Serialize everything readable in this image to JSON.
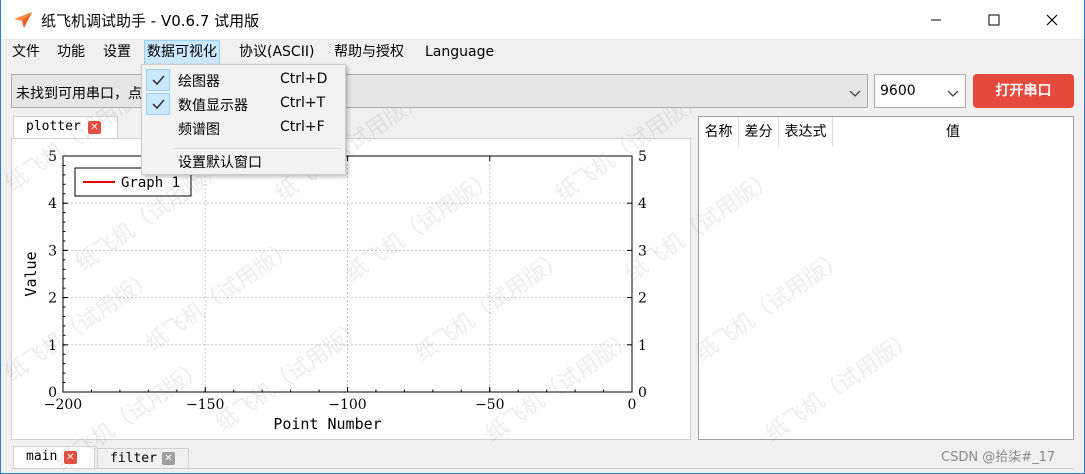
{
  "window": {
    "title": "纸飞机调试助手 - V0.6.7 试用版",
    "icon": "paper-plane-icon"
  },
  "menubar": {
    "items": [
      {
        "label": "文件"
      },
      {
        "label": "功能"
      },
      {
        "label": "设置"
      },
      {
        "label": "数据可视化",
        "active": true
      },
      {
        "label": "协议(ASCII)"
      },
      {
        "label": "帮助与授权"
      },
      {
        "label": "Language"
      }
    ]
  },
  "dropdown": {
    "items": [
      {
        "label": "绘图器",
        "shortcut": "Ctrl+D",
        "checked": true
      },
      {
        "label": "数值显示器",
        "shortcut": "Ctrl+T",
        "checked": true
      },
      {
        "label": "频谱图",
        "shortcut": "Ctrl+F",
        "checked": false
      },
      {
        "label": "设置默认窗口",
        "shortcut": "",
        "checked": false
      }
    ]
  },
  "toolbar": {
    "port_text": "未找到可用串口，⁠点",
    "baud": "9600",
    "open_button": "打开串口"
  },
  "plot_tabs": [
    {
      "label": "plotter",
      "close_color": "#e64a3c"
    }
  ],
  "chart_data": {
    "type": "line",
    "series": [
      {
        "name": "Graph 1",
        "color": "#e00000",
        "x": [],
        "y": []
      }
    ],
    "xlabel": "Point Number",
    "ylabel": "Value",
    "xlim": [
      -200,
      0
    ],
    "ylim": [
      0,
      5
    ],
    "x_ticks": [
      "−200",
      "−150",
      "−100",
      "−50",
      "0"
    ],
    "y_ticks": [
      "0",
      "1",
      "2",
      "3",
      "4",
      "5"
    ],
    "grid": true,
    "legend": "top-left"
  },
  "value_table": {
    "columns": [
      "名称",
      "差分",
      "表达式",
      "值"
    ]
  },
  "bottom_tabs": [
    {
      "label": "main",
      "close_color": "#e64a3c"
    },
    {
      "label": "filter",
      "close_color": "#a0a0a0"
    }
  ],
  "watermark": "纸飞机（试用版）",
  "footer_credit": "CSDN @拾柒#_17",
  "colors": {
    "accent": "#e64a3c",
    "menu_highlight": "#cce8ff"
  }
}
